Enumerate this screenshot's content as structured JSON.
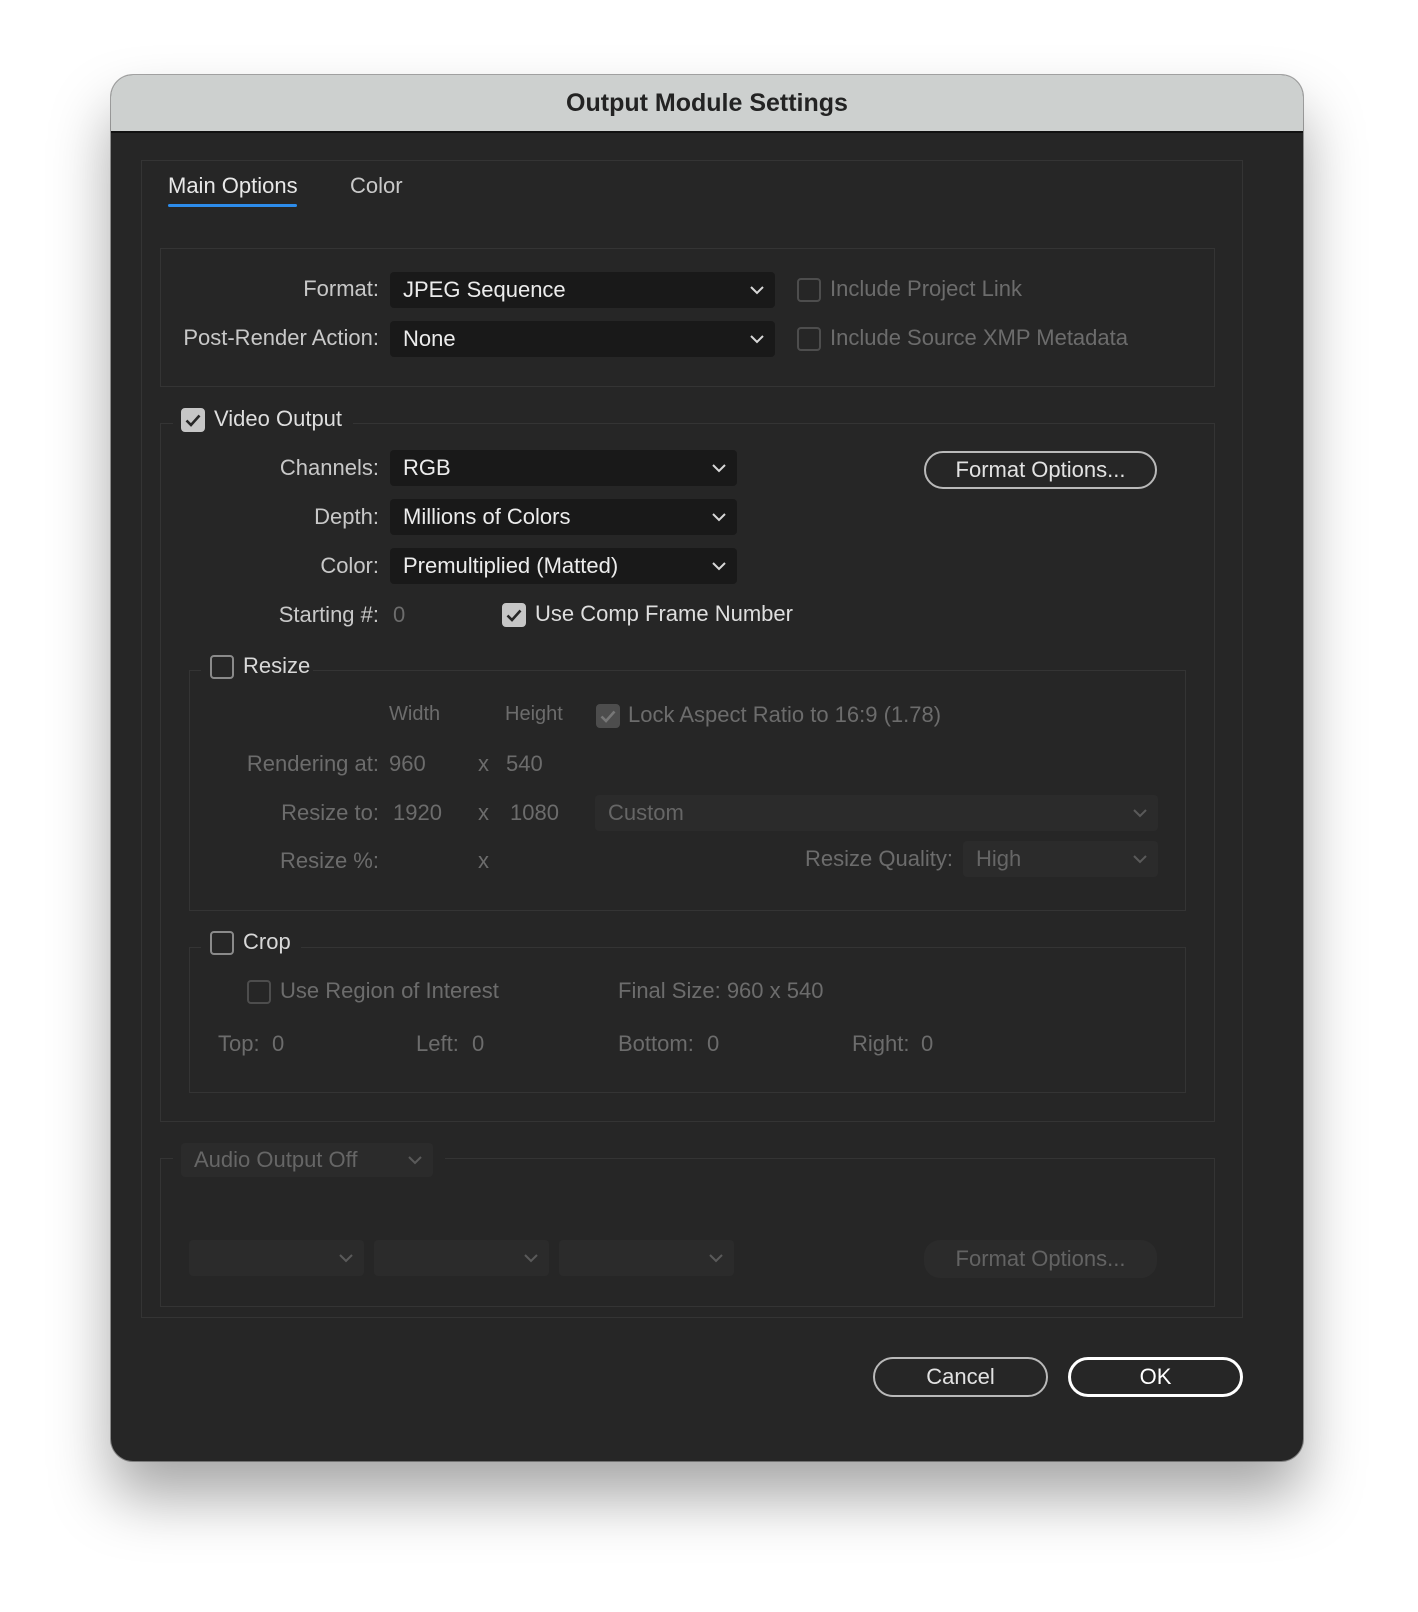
{
  "window": {
    "title": "Output Module Settings"
  },
  "tabs": [
    {
      "label": "Main Options",
      "active": true
    },
    {
      "label": "Color",
      "active": false
    }
  ],
  "general": {
    "format_label": "Format:",
    "format_value": "JPEG Sequence",
    "post_render_label": "Post-Render Action:",
    "post_render_value": "None",
    "include_project_link": "Include Project Link",
    "include_xmp": "Include Source XMP Metadata"
  },
  "video": {
    "section_label": "Video Output",
    "checked": true,
    "channels_label": "Channels:",
    "channels_value": "RGB",
    "depth_label": "Depth:",
    "depth_value": "Millions of Colors",
    "color_label": "Color:",
    "color_value": "Premultiplied (Matted)",
    "starting_label": "Starting #:",
    "starting_value": "0",
    "use_comp_frame": "Use Comp Frame Number",
    "format_options": "Format Options..."
  },
  "resize": {
    "section_label": "Resize",
    "width_header": "Width",
    "height_header": "Height",
    "lock_aspect": "Lock Aspect Ratio to 16:9 (1.78)",
    "rendering_at_label": "Rendering at:",
    "rendering_w": "960",
    "rendering_h": "540",
    "resize_to_label": "Resize to:",
    "resize_w": "1920",
    "resize_h": "1080",
    "preset_value": "Custom",
    "resize_pct_label": "Resize %:",
    "x": "x",
    "quality_label": "Resize Quality:",
    "quality_value": "High"
  },
  "crop": {
    "section_label": "Crop",
    "use_roi": "Use Region of Interest",
    "final_size": "Final Size: 960 x 540",
    "top_label": "Top:",
    "top_value": "0",
    "left_label": "Left:",
    "left_value": "0",
    "bottom_label": "Bottom:",
    "bottom_value": "0",
    "right_label": "Right:",
    "right_value": "0"
  },
  "audio": {
    "mode_value": "Audio Output Off",
    "format_options": "Format Options..."
  },
  "footer": {
    "cancel": "Cancel",
    "ok": "OK"
  },
  "colors": {
    "dialog_bg": "#262626",
    "titlebar_bg": "#cdd0cf",
    "accent": "#2d8ceb"
  }
}
